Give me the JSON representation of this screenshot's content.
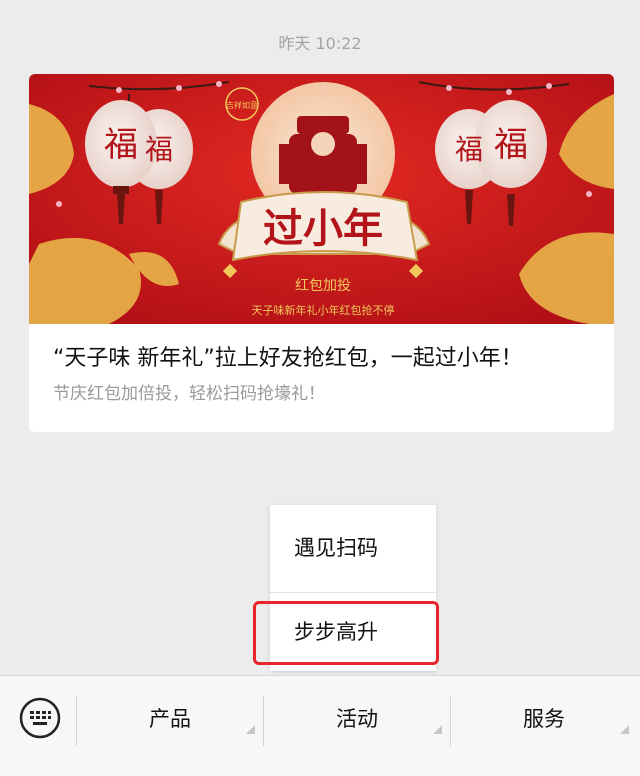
{
  "timestamp": "昨天 10:22",
  "card": {
    "title": "“天子味 新年礼”拉上好友抢红包，一起过小年！",
    "description": "节庆红包加倍投，轻松扫码抢壕礼！",
    "banner": {
      "main_text": "过小年",
      "top_left_seal": "吉祥如意",
      "lantern_char_left": "福",
      "lantern_char_right": "福",
      "red_packet_text": "红包加投",
      "slogan": "天子味新年礼小年红包抢不停"
    }
  },
  "popup_menu": {
    "items": [
      {
        "label": "遇见扫码"
      },
      {
        "label": "步步高升"
      }
    ]
  },
  "bottom_menu": {
    "items": [
      {
        "label": "产品"
      },
      {
        "label": "活动"
      },
      {
        "label": "服务"
      }
    ]
  },
  "colors": {
    "banner_red": "#c8141b",
    "gold": "#e8b84a",
    "highlight": "#e8252a",
    "background": "#ececec"
  }
}
